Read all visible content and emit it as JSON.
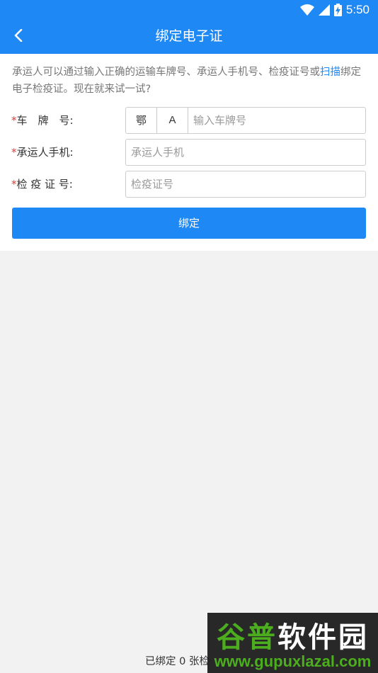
{
  "status_bar": {
    "time": "5:50",
    "icons": [
      "wifi-icon",
      "signal-icon",
      "battery-charging-icon"
    ]
  },
  "app_bar": {
    "title": "绑定电子证",
    "back_icon": "back-arrow-icon"
  },
  "intro": {
    "text_before": "承运人可以通过输入正确的运输车牌号、承运人手机号、检疫证号或",
    "link": "扫描",
    "text_after": "绑定电子检疫证。现在就来试一试?"
  },
  "form": {
    "required_mark": "*",
    "plate": {
      "label": "车　牌　号:",
      "province": "鄂",
      "letter": "A",
      "value": "",
      "placeholder": "输入车牌号"
    },
    "phone": {
      "label": "承运人手机:",
      "value": "",
      "placeholder": "承运人手机"
    },
    "cert": {
      "label": "检 疫 证 号:",
      "value": "",
      "placeholder": "检疫证号"
    }
  },
  "bind_button": {
    "label": "绑定"
  },
  "footer": {
    "text": "已绑定 0 张检"
  },
  "watermark": {
    "title": "谷普软件园",
    "url": "www.gupuxlazal.com"
  },
  "colors": {
    "primary": "#1e88f5",
    "required": "#e53935",
    "background": "#f2f2f2",
    "watermark_green": "#4cae1f"
  }
}
